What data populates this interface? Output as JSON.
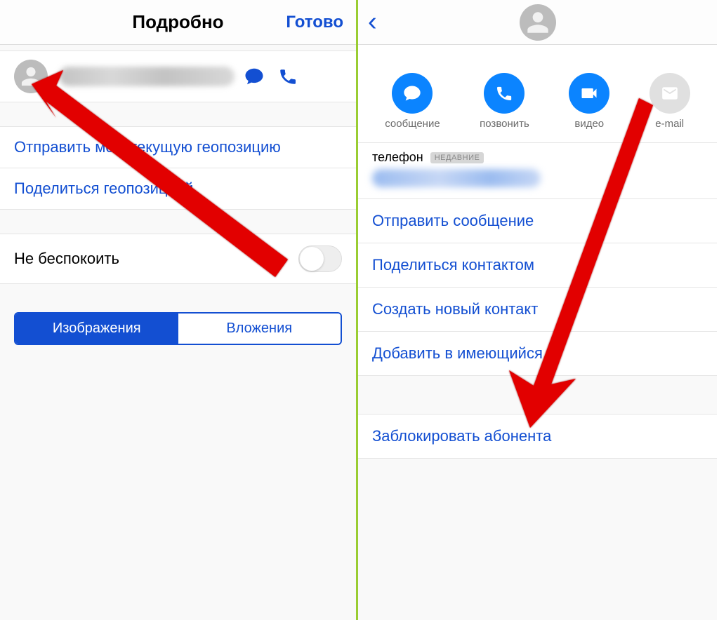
{
  "left": {
    "nav": {
      "title": "Подробно",
      "done": "Готово"
    },
    "shareLocation": "Отправить мою текущую геопозицию",
    "shareLiveLocation": "Поделиться геопозицией",
    "dnd": "Не беспокоить",
    "seg": {
      "images": "Изображения",
      "attachments": "Вложения"
    }
  },
  "right": {
    "actions": {
      "message": "сообщение",
      "call": "позвонить",
      "video": "видео",
      "email": "e-mail"
    },
    "phoneLabel": "телефон",
    "badge": "НЕДАВНИЕ",
    "sendMessage": "Отправить сообщение",
    "shareContact": "Поделиться контактом",
    "createContact": "Создать новый контакт",
    "addExisting": "Добавить в имеющийся",
    "block": "Заблокировать абонента"
  }
}
